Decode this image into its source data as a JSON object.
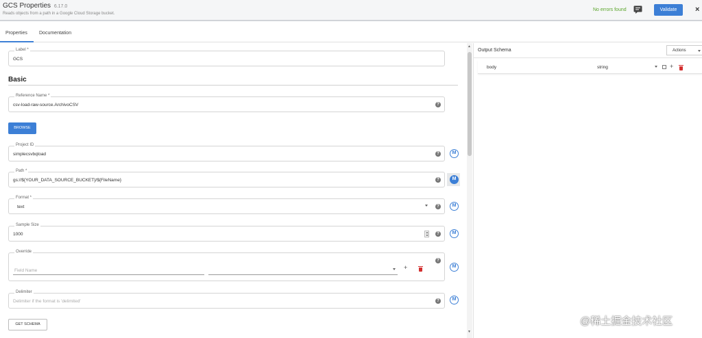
{
  "header": {
    "title": "GCS Properties",
    "version": "6.17.0",
    "subtitle": "Reads objects from a path in a Google Cloud Storage bucket.",
    "status": "No errors found",
    "validate_label": "Validate",
    "close_label": "×"
  },
  "tabs": [
    {
      "label": "Properties",
      "active": true
    },
    {
      "label": "Documentation",
      "active": false
    }
  ],
  "form": {
    "label": {
      "label": "Label *",
      "value": "GCS"
    },
    "section_title": "Basic",
    "reference_name": {
      "label": "Reference Name *",
      "value": "csv-load-raw-source.ArchivoCSV"
    },
    "browse_label": "BROWSE",
    "project_id": {
      "label": "Project ID",
      "value": "simplecsvbqload"
    },
    "path": {
      "label": "Path *",
      "value": "gs://${YOUR_DATA_SOURCE_BUCKET}/${FileName}"
    },
    "format": {
      "label": "Format *",
      "value": "text"
    },
    "sample_size": {
      "label": "Sample Size",
      "value": "1000"
    },
    "override": {
      "label": "Override",
      "field_name_placeholder": "Field Name"
    },
    "delimiter": {
      "label": "Delimiter",
      "placeholder": "Delimiter if the format is 'delimited'"
    },
    "get_schema_label": "GET SCHEMA",
    "help_glyph": "?",
    "macro_glyph": "M"
  },
  "output_schema": {
    "title": "Output Schema",
    "actions_label": "Actions",
    "rows": [
      {
        "name": "body",
        "type": "string"
      }
    ]
  },
  "watermark": "@稀土掘金技术社区",
  "icons": {
    "comment": "comment-icon",
    "help": "help-icon",
    "macro": "macro-icon",
    "trash": "trash-icon",
    "plus": "plus-icon"
  },
  "colors": {
    "accent": "#3c7fd6",
    "success": "#5aa52a",
    "danger": "#d32f2f"
  }
}
